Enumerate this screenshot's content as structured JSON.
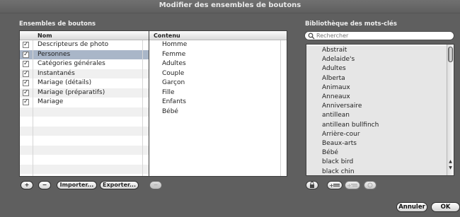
{
  "window": {
    "title": "Modifier des ensembles de boutons"
  },
  "left": {
    "section_title": "Ensembles de boutons",
    "table": {
      "col_nom": "Nom",
      "col_contenu": "Contenu",
      "sets": [
        {
          "name": "Descripteurs de photo",
          "checked": true
        },
        {
          "name": "Personnes",
          "checked": true,
          "selected": true
        },
        {
          "name": "Catégories générales",
          "checked": true
        },
        {
          "name": "Instantanés",
          "checked": true
        },
        {
          "name": "Mariage (détails)",
          "checked": true
        },
        {
          "name": "Mariage (préparatifs)",
          "checked": true
        },
        {
          "name": "Mariage",
          "checked": true
        }
      ],
      "contents": [
        "Homme",
        "Femme",
        "Adultes",
        "Couple",
        "Garçon",
        "Fille",
        "Enfants",
        "Bébé"
      ]
    },
    "buttons": {
      "add": "+",
      "remove": "−",
      "import": "Importer...",
      "export": "Exporter...",
      "remove_content": "−"
    }
  },
  "right": {
    "section_title": "Bibliothèque des mots-clés",
    "search": {
      "placeholder": "Rechercher"
    },
    "keywords": [
      "Abstrait",
      "Adelaide's",
      "Adultes",
      "Alberta",
      "Animaux",
      "Anneaux",
      "Anniversaire",
      "antillean",
      "antillean bullfinch",
      "Arrière-cour",
      "Beaux-arts",
      "Bébé",
      "black bird",
      "black chin"
    ]
  },
  "dialog": {
    "cancel": "Annuler",
    "ok": "OK"
  },
  "colors": {
    "window_bg": "#5f5f5f",
    "selection": "#a9b6c8"
  }
}
